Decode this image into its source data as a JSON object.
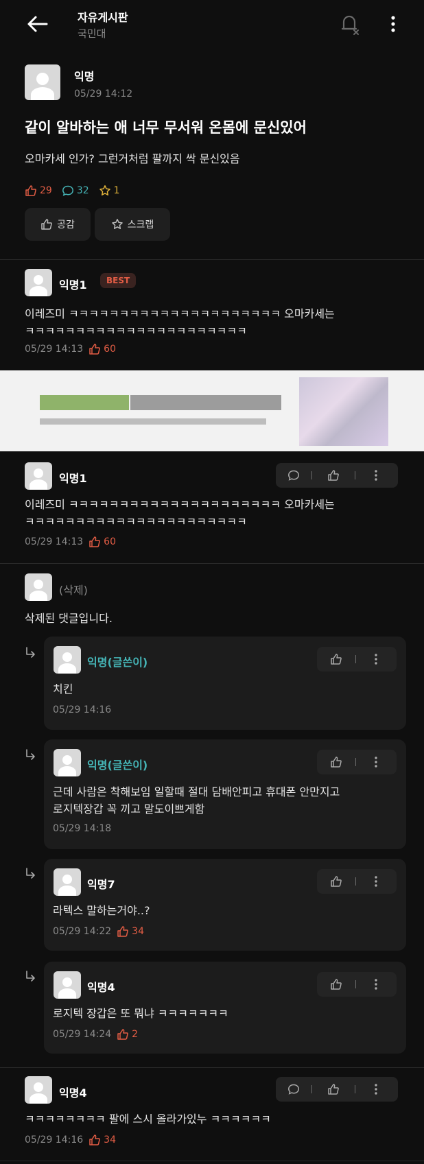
{
  "header": {
    "board_title": "자유게시판",
    "school": "국민대"
  },
  "post": {
    "author": "익명",
    "time": "05/29 14:12",
    "title": "같이 알바하는 애 너무 무서워 온몸에 문신있어",
    "body": "오마카세 인가? 그런거처럼 팔까지 싹 문신있음",
    "likes": "29",
    "comments": "32",
    "scraps": "1",
    "like_button": "공감",
    "scrap_button": "스크랩"
  },
  "best": {
    "author": "익명1",
    "badge": "BEST",
    "line1": "이레즈미 ㅋㅋㅋㅋㅋㅋㅋㅋㅋㅋㅋㅋㅋㅋㅋㅋㅋㅋㅋㅋㅋ 오마카세는",
    "line2": "ㅋㅋㅋㅋㅋㅋㅋㅋㅋㅋㅋㅋㅋㅋㅋㅋㅋㅋㅋㅋㅋㅋ",
    "time": "05/29 14:13",
    "likes": "60"
  },
  "comment1": {
    "author": "익명1",
    "line1": "이레즈미 ㅋㅋㅋㅋㅋㅋㅋㅋㅋㅋㅋㅋㅋㅋㅋㅋㅋㅋㅋㅋㅋ 오마카세는",
    "line2": "ㅋㅋㅋㅋㅋㅋㅋㅋㅋㅋㅋㅋㅋㅋㅋㅋㅋㅋㅋㅋㅋㅋ",
    "time": "05/29 14:13",
    "likes": "60"
  },
  "deleted": {
    "author": "(삭제)",
    "text": "삭제된 댓글입니다."
  },
  "replies": [
    {
      "author": "익명(글쓴이)",
      "line1": "치킨",
      "line2": "",
      "time": "05/29 14:16",
      "likes": ""
    },
    {
      "author": "익명(글쓴이)",
      "line1": "근데 사람은 착해보임 일할때 절대 담배안피고 휴대폰 안만지고",
      "line2": "로지텍장갑 꼭 끼고 말도이쁘게함",
      "time": "05/29 14:18",
      "likes": ""
    },
    {
      "author": "익명7",
      "line1": "라텍스 말하는거야..?",
      "line2": "",
      "time": "05/29 14:22",
      "likes": "34"
    },
    {
      "author": "익명4",
      "line1": "로지텍 장갑은 또 뭐냐 ㅋㅋㅋㅋㅋㅋㅋ",
      "line2": "",
      "time": "05/29 14:24",
      "likes": "2"
    }
  ],
  "comment4": {
    "author": "익명4",
    "text": "ㅋㅋㅋㅋㅋㅋㅋㅋ 팔에 스시 올라가있누 ㅋㅋㅋㅋㅋㅋ",
    "time": "05/29 14:16",
    "likes": "34"
  },
  "colors": {
    "accent_red": "#e35d45",
    "writer_teal": "#45b3b5",
    "star_gold": "#e0b23a",
    "background": "#0f0f0f"
  }
}
